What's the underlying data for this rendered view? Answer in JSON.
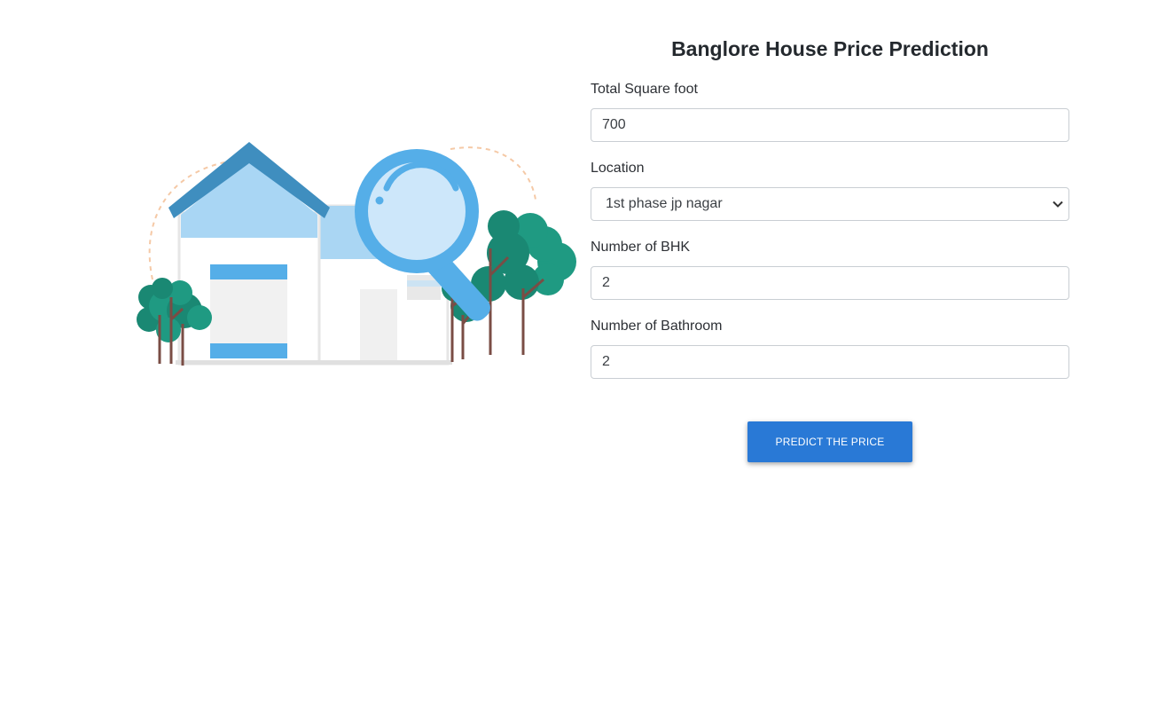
{
  "header": {
    "title": "Banglore House Price Prediction"
  },
  "form": {
    "sqft": {
      "label": "Total Square foot",
      "value": "700"
    },
    "location": {
      "label": "Location",
      "selected": "1st phase jp nagar"
    },
    "bhk": {
      "label": "Number of BHK",
      "value": "2"
    },
    "bathroom": {
      "label": "Number of Bathroom",
      "value": "2"
    },
    "submit_label": "PREDICT THE PRICE"
  },
  "illustration": {
    "icon": "house-search-illustration"
  },
  "colors": {
    "button": "#2979d6",
    "roof": "#3f8ebf",
    "accent_blue": "#55aee8",
    "tree_green": "#1f9a82",
    "trunk": "#7a4d45"
  }
}
